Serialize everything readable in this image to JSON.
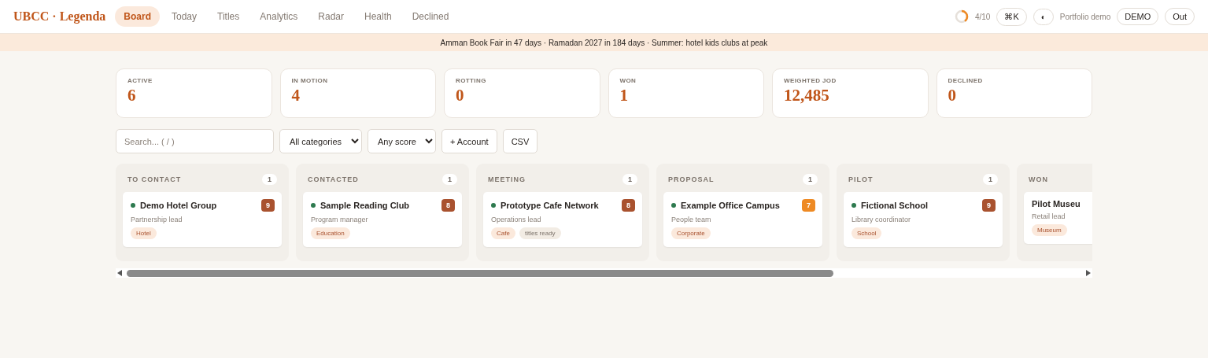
{
  "brand": "UBCC · Legenda",
  "nav": [
    {
      "label": "Board",
      "selected": true
    },
    {
      "label": "Today",
      "selected": false
    },
    {
      "label": "Titles",
      "selected": false
    },
    {
      "label": "Analytics",
      "selected": false
    },
    {
      "label": "Radar",
      "selected": false
    },
    {
      "label": "Health",
      "selected": false
    },
    {
      "label": "Declined",
      "selected": false
    }
  ],
  "progress": {
    "level": 0.4,
    "label": "4/10"
  },
  "command_button": "⌘K",
  "theme_button": "◐",
  "user": "Portfolio demo",
  "mode_button": "DEMO",
  "logout_button": "Out",
  "banner": "Amman Book Fair in 47 days · Ramadan 2027 in 184 days · Summer: hotel kids clubs at peak",
  "stats": [
    {
      "label": "ACTIVE",
      "value": "6"
    },
    {
      "label": "IN MOTION",
      "value": "4"
    },
    {
      "label": "ROTTING",
      "value": "0"
    },
    {
      "label": "WON",
      "value": "1"
    },
    {
      "label": "WEIGHTED JOD",
      "value": "12,485"
    },
    {
      "label": "DECLINED",
      "value": "0"
    }
  ],
  "toolbar": {
    "search": {
      "placeholder": "Search... ( / )"
    },
    "category_filter": "All categories",
    "score_filter": "Any score",
    "add_button": "+ Account",
    "export_button": "CSV"
  },
  "columns": [
    {
      "title": "TO CONTACT",
      "count": "1",
      "cards": [
        {
          "name": "Demo Hotel Group",
          "role": "Partnership lead",
          "dot": true,
          "score": "9",
          "color": "#a9522f",
          "tags": [
            {
              "label": "Hotel",
              "kind": "category"
            }
          ]
        }
      ]
    },
    {
      "title": "CONTACTED",
      "count": "1",
      "cards": [
        {
          "name": "Sample Reading Club",
          "role": "Program manager",
          "dot": true,
          "score": "8",
          "color": "#a9522f",
          "tags": [
            {
              "label": "Education",
              "kind": "category"
            }
          ]
        }
      ]
    },
    {
      "title": "MEETING",
      "count": "1",
      "cards": [
        {
          "name": "Prototype Cafe Network",
          "role": "Operations lead",
          "dot": true,
          "score": "8",
          "color": "#a9522f",
          "tags": [
            {
              "label": "Cafe",
              "kind": "category"
            },
            {
              "label": "titles ready",
              "kind": "status"
            }
          ]
        }
      ]
    },
    {
      "title": "PROPOSAL",
      "count": "1",
      "cards": [
        {
          "name": "Example Office Campus",
          "role": "People team",
          "dot": true,
          "score": "7",
          "color": "#ee8a24",
          "tags": [
            {
              "label": "Corporate",
              "kind": "category"
            }
          ]
        }
      ]
    },
    {
      "title": "PILOT",
      "count": "1",
      "cards": [
        {
          "name": "Fictional School",
          "role": "Library coordinator",
          "dot": true,
          "score": "9",
          "color": "#a9522f",
          "tags": [
            {
              "label": "School",
              "kind": "category"
            }
          ]
        }
      ]
    },
    {
      "title": "WON",
      "cards": [
        {
          "name": "Pilot Museu",
          "role": "Retail lead",
          "dot": false,
          "tags": [
            {
              "label": "Museum",
              "kind": "category"
            }
          ]
        }
      ]
    }
  ]
}
